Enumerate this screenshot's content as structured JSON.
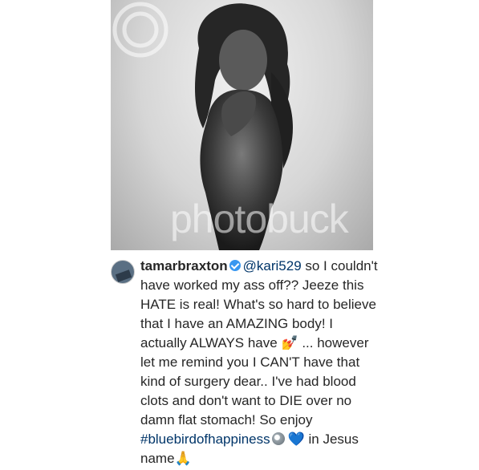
{
  "photo": {
    "watermark_text": "photobuck",
    "alt": "photo-image"
  },
  "comment": {
    "username": "tamarbraxton",
    "mention": "@kari529",
    "line_a": " so I couldn't have worked my ass off?? Jeeze this HATE is real! What's so hard to believe that I have an AMAZING body! I actually ALWAYS have ",
    "emoji_nails": "💅",
    "line_b": " ... however let me remind you I CAN'T have that kind of surgery dear.. I've had blood clots and don't want to DIE over no damn flat stomach! So enjoy ",
    "hashtag": "#bluebirdofhappiness",
    "emoji_heart": "💙",
    "line_c": " in Jesus name",
    "emoji_pray": "🙏"
  },
  "colors": {
    "link": "#003569",
    "verified": "#3897f0",
    "text": "#262626"
  }
}
